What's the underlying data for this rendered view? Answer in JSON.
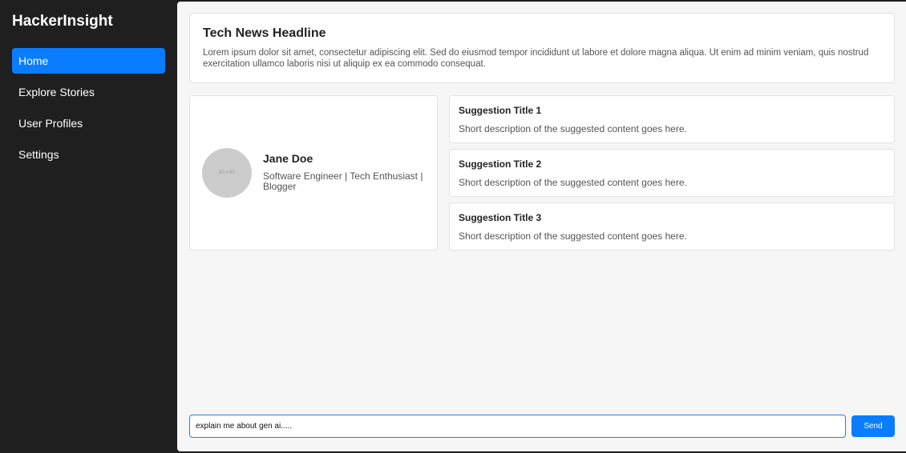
{
  "sidebar": {
    "brand": "HackerInsight",
    "items": [
      {
        "label": "Home",
        "active": true
      },
      {
        "label": "Explore Stories",
        "active": false
      },
      {
        "label": "User Profiles",
        "active": false
      },
      {
        "label": "Settings",
        "active": false
      }
    ]
  },
  "headline": {
    "title": "Tech News Headline",
    "text": "Lorem ipsum dolor sit amet, consectetur adipiscing elit. Sed do eiusmod tempor incididunt ut labore et dolore magna aliqua. Ut enim ad minim veniam, quis nostrud exercitation ullamco laboris nisi ut aliquip ex ea commodo consequat."
  },
  "profile": {
    "avatar_text": "80 x 80",
    "name": "Jane Doe",
    "bio": "Software Engineer | Tech Enthusiast | Blogger"
  },
  "suggestions": [
    {
      "title": "Suggestion Title 1",
      "description": "Short description of the suggested content goes here."
    },
    {
      "title": "Suggestion Title 2",
      "description": "Short description of the suggested content goes here."
    },
    {
      "title": "Suggestion Title 3",
      "description": "Short description of the suggested content goes here."
    }
  ],
  "chat": {
    "input_value": "explain me about gen ai.....",
    "send_label": "Send"
  },
  "colors": {
    "accent": "#0a7cff",
    "sidebar_bg": "#1f1f1f",
    "main_bg": "#f6f6f6"
  }
}
